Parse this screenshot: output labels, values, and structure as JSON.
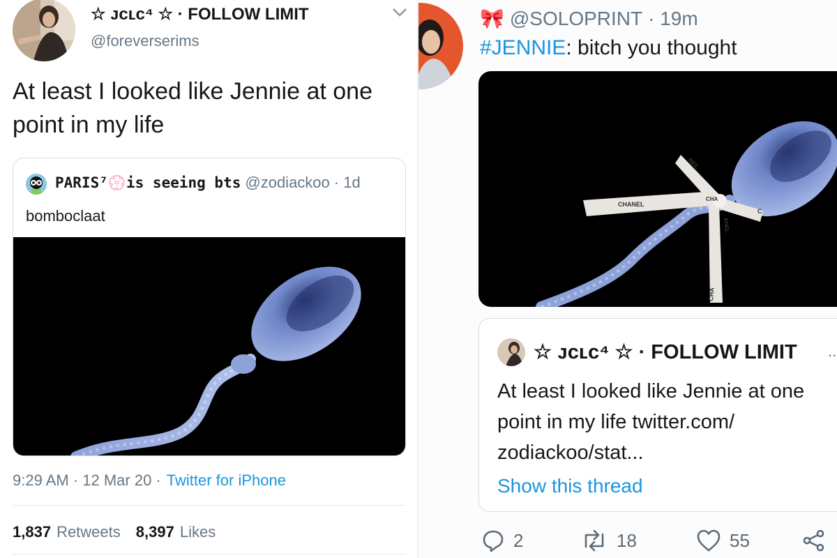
{
  "left": {
    "author": {
      "display_name": "☆ ᴊᴄʟᴄ⁴ ☆ · FOLLOW LIMIT",
      "handle": "@foreverserims"
    },
    "tweet_text_line1": "At least I looked like Jennie at one",
    "tweet_text_line2": "point in my life",
    "quoted": {
      "display_name": "PARIS⁷💮is seeing bts",
      "handle": "@zodiackoo",
      "time": "· 1d",
      "text": "bomboclaat"
    },
    "meta": {
      "time": "9:29 AM · 12 Mar 20 ·",
      "source": "Twitter for iPhone"
    },
    "stats": {
      "retweets_count": "1,837",
      "retweets_label": "Retweets",
      "likes_count": "8,397",
      "likes_label": "Likes"
    }
  },
  "right": {
    "author": {
      "emoji": "🎀",
      "handle": "@SOLOPRINT",
      "time": "· 19m"
    },
    "tweet_hashtag": "#JENNIE",
    "tweet_text": ": bitch you thought",
    "ribbon_labels": [
      "NEL",
      "CHANEL",
      "CHA",
      "ANEL",
      "CHA",
      "C"
    ],
    "quoted": {
      "display_name": "☆ ᴊᴄʟᴄ⁴ ☆ · FOLLOW LIMIT",
      "more": "...",
      "text_line1": "At least I looked like Jennie at one",
      "text_line2": "point in my life twitter.com/",
      "text_line3": "zodiackoo/stat...",
      "show_thread": "Show this thread"
    },
    "actions": {
      "reply_count": "2",
      "retweet_count": "18",
      "like_count": "55"
    }
  },
  "colors": {
    "link": "#1b95e0",
    "muted": "#657786",
    "sperm_blue": "#6f86c9"
  }
}
